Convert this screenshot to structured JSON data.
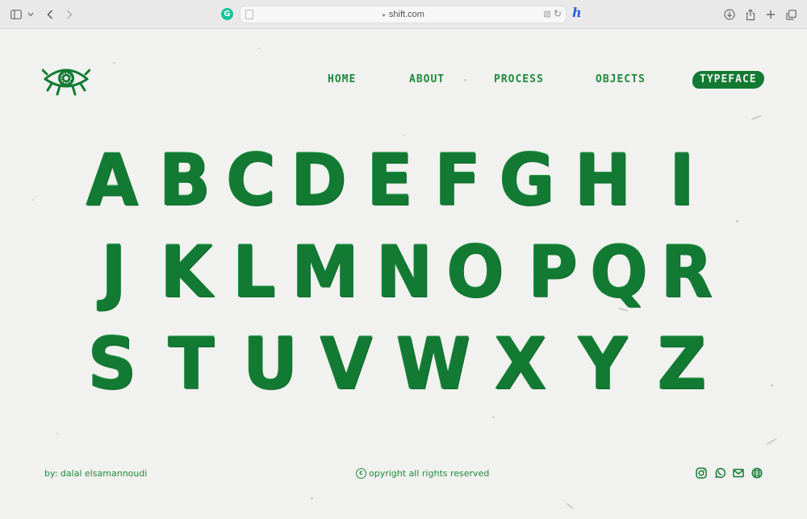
{
  "browser": {
    "url": "shift.com",
    "icons": [
      "sidebar-icon",
      "chevron-down-icon",
      "back-icon",
      "forward-icon",
      "grammarly-icon",
      "page-icon",
      "lock-icon",
      "translate-icon",
      "reload-icon",
      "honey-extension-icon",
      "download-icon",
      "share-icon",
      "new-tab-icon",
      "tabs-overview-icon"
    ]
  },
  "logo": {
    "icon": "eye-icon"
  },
  "nav": {
    "items": [
      {
        "label": "HOME"
      },
      {
        "label": "ABOUT"
      },
      {
        "label": "PROCESS"
      },
      {
        "label": "OBJECTS"
      },
      {
        "label": "TYPEFACE",
        "active": true
      }
    ]
  },
  "alphabet": {
    "rows": [
      [
        "A",
        "B",
        "C",
        "D",
        "E",
        "F",
        "G",
        "H",
        "I"
      ],
      [
        "J",
        "K",
        "L",
        "M",
        "N",
        "O",
        "P",
        "Q",
        "R"
      ],
      [
        "S",
        "T",
        "U",
        "V",
        "W",
        "X",
        "Y",
        "Z"
      ]
    ]
  },
  "footer": {
    "author": "by: dalal elsamannoudi",
    "copyright": "opyright all rights reserved",
    "social": [
      "instagram-icon",
      "whatsapp-icon",
      "mail-icon",
      "globe-icon"
    ]
  },
  "colors": {
    "accent": "#127a33",
    "background": "#f1f1ef"
  }
}
